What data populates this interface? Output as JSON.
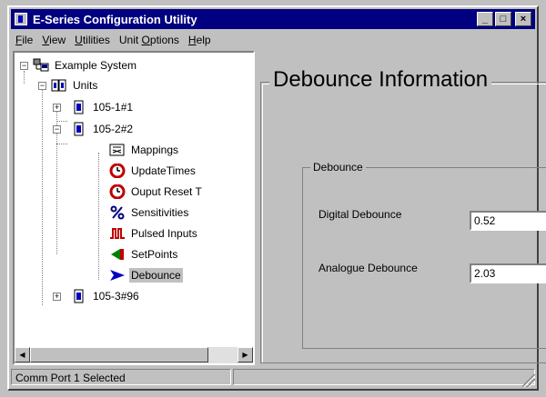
{
  "window": {
    "title": "E-Series Configuration Utility"
  },
  "title_buttons": {
    "minimize": "_",
    "maximize": "□",
    "close": "×"
  },
  "menu": [
    {
      "label": "File",
      "u": "F",
      "rest": "ile"
    },
    {
      "label": "View",
      "u": "V",
      "rest": "iew"
    },
    {
      "label": "Utilities",
      "u": "U",
      "rest": "tilities"
    },
    {
      "label": "Unit Options",
      "pre": "Unit ",
      "u": "O",
      "rest": "ptions"
    },
    {
      "label": "Help",
      "u": "H",
      "rest": "elp"
    }
  ],
  "tree": {
    "root": {
      "label": "Example System",
      "icon": "network-icon"
    },
    "units": {
      "label": "Units",
      "icon": "units-folder-icon"
    },
    "unit1": {
      "label": "105-1#1",
      "icon": "unit-icon"
    },
    "unit2": {
      "label": "105-2#2",
      "icon": "unit-icon"
    },
    "children": [
      {
        "label": "Mappings",
        "icon": "mappings-icon"
      },
      {
        "label": "UpdateTimes",
        "icon": "clock-icon"
      },
      {
        "label": "Ouput Reset T",
        "icon": "clock-icon"
      },
      {
        "label": "Sensitivities",
        "icon": "percent-icon"
      },
      {
        "label": "Pulsed Inputs",
        "icon": "pulse-icon"
      },
      {
        "label": "SetPoints",
        "icon": "setpoints-icon"
      },
      {
        "label": "Debounce",
        "icon": "arrow-icon",
        "selected": true
      }
    ],
    "unit3": {
      "label": "105-3#96",
      "icon": "unit-icon"
    }
  },
  "panel": {
    "heading": "Debounce Information",
    "group_title": "Debounce",
    "digital_label": "Digital Debounce",
    "digital_value": "0.52",
    "analogue_label": "Analogue Debounce",
    "analogue_value": "2.03"
  },
  "status": {
    "text": "Comm Port 1 Selected",
    "panel2": ""
  }
}
